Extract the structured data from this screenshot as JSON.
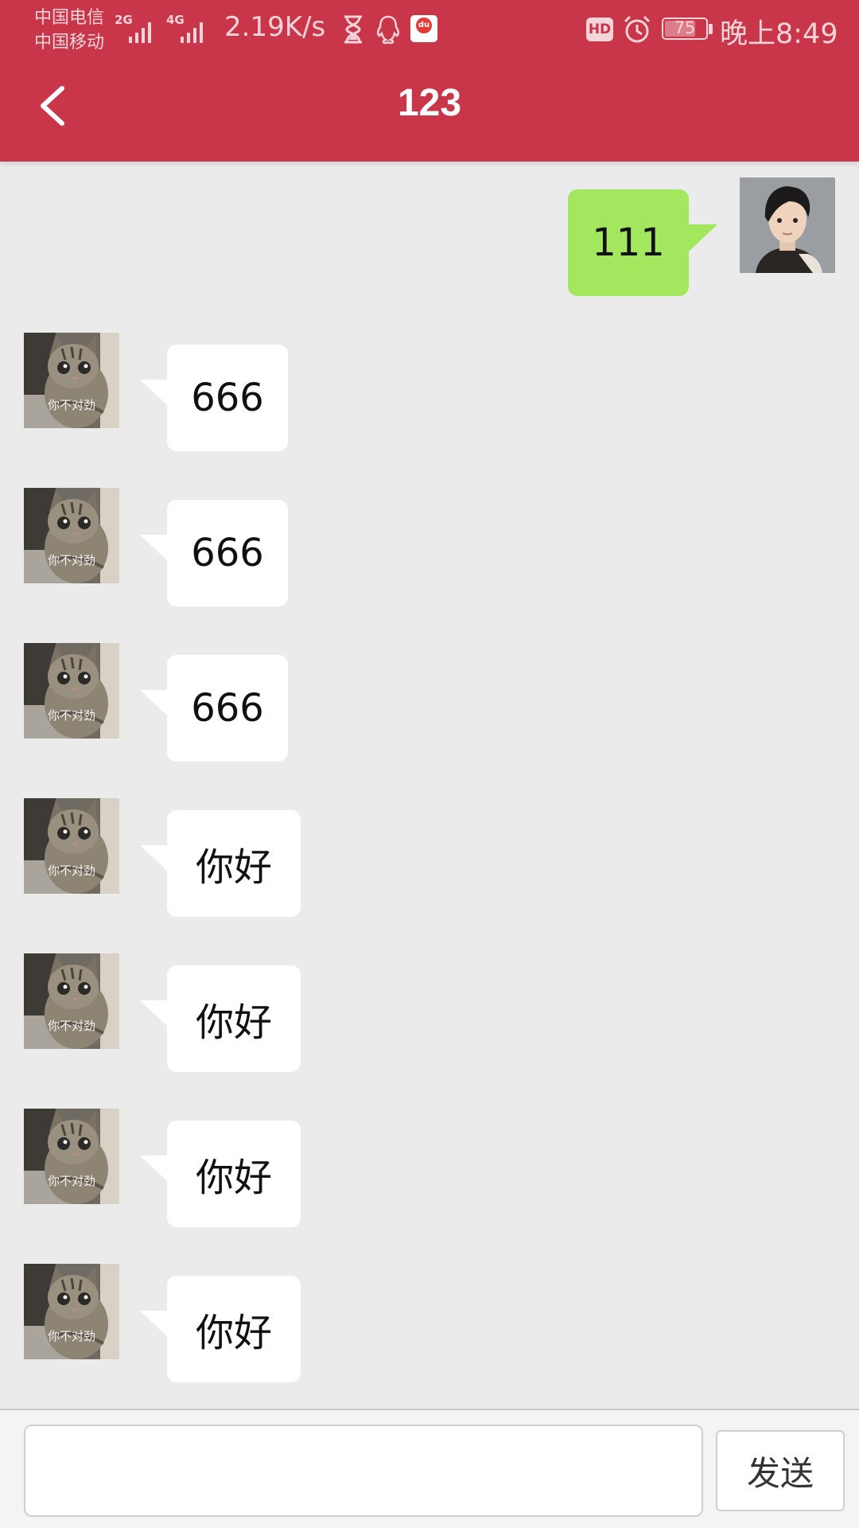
{
  "status_bar": {
    "carrier_1": "中国电信",
    "carrier_2": "中国移动",
    "signal_1_type": "2G",
    "signal_2_type": "4G",
    "net_speed": "2.19K/s",
    "hd_label": "HD",
    "battery_level": "75",
    "time": "晚上8:49",
    "icons": [
      "hourglass-icon",
      "qq-icon",
      "baidu-map-icon",
      "alarm-icon",
      "battery-icon"
    ]
  },
  "header": {
    "title": "123",
    "back_icon": "chevron-left-icon"
  },
  "messages": [
    {
      "side": "right",
      "text": "111",
      "avatar": "user-avatar"
    },
    {
      "side": "left",
      "text": "666",
      "avatar": "cat-avatar"
    },
    {
      "side": "left",
      "text": "666",
      "avatar": "cat-avatar"
    },
    {
      "side": "left",
      "text": "666",
      "avatar": "cat-avatar"
    },
    {
      "side": "left",
      "text": "你好",
      "avatar": "cat-avatar"
    },
    {
      "side": "left",
      "text": "你好",
      "avatar": "cat-avatar"
    },
    {
      "side": "left",
      "text": "你好",
      "avatar": "cat-avatar"
    },
    {
      "side": "left",
      "text": "你好",
      "avatar": "cat-avatar"
    }
  ],
  "avatar_caption": "你不对劲",
  "input": {
    "value": "",
    "placeholder": "",
    "send_label": "发送"
  },
  "colors": {
    "header_red": "#c9364a",
    "chat_background": "#ebebeb",
    "sent_bubble_green": "#a3e75e",
    "received_bubble_white": "#ffffff"
  }
}
